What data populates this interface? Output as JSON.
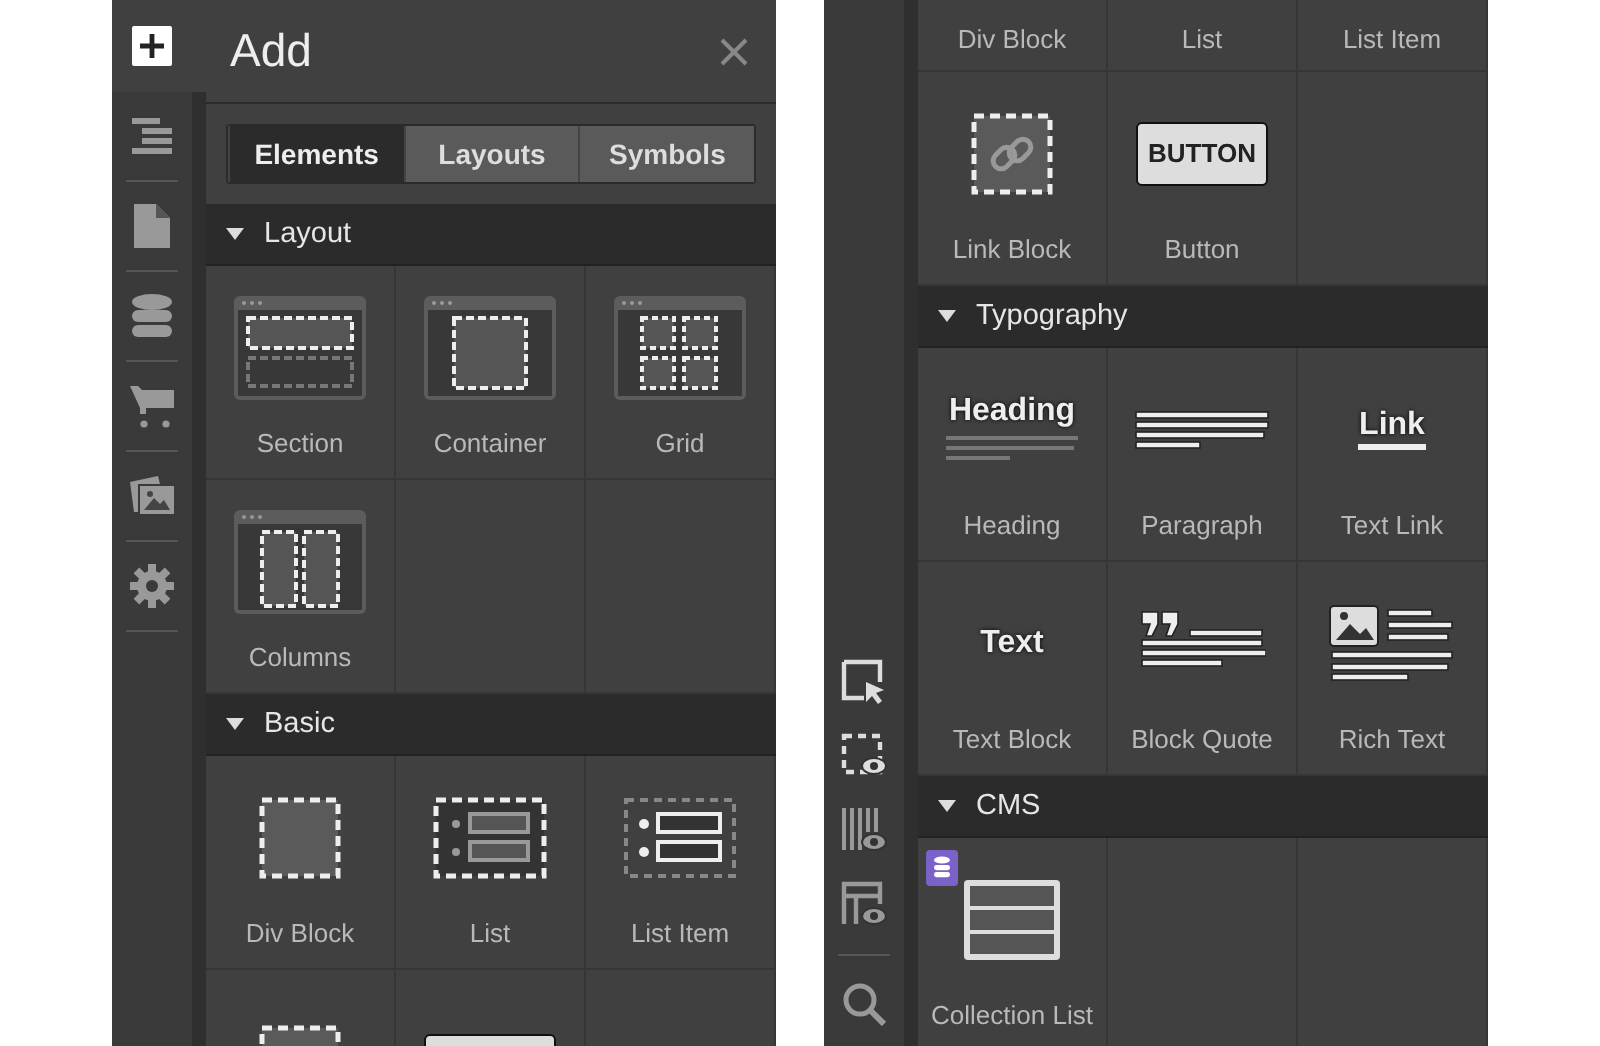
{
  "add_panel": {
    "rail": [
      {
        "kind": "add",
        "selected": true
      },
      {
        "kind": "navigator",
        "selected": false
      },
      {
        "kind": "pages",
        "selected": false
      },
      {
        "kind": "cms",
        "selected": false
      },
      {
        "kind": "ecommerce",
        "selected": false
      },
      {
        "kind": "assets",
        "selected": false
      },
      {
        "kind": "settings",
        "selected": false
      }
    ],
    "title": "Add",
    "tabs": [
      {
        "label": "Elements",
        "selected": true
      },
      {
        "label": "Layouts",
        "selected": false
      },
      {
        "label": "Symbols",
        "selected": false
      }
    ],
    "sections": [
      {
        "title": "Layout",
        "expanded": true,
        "items": [
          {
            "kind": "section",
            "label": "Section"
          },
          {
            "kind": "container",
            "label": "Container"
          },
          {
            "kind": "grid",
            "label": "Grid"
          },
          {
            "kind": "columns",
            "label": "Columns"
          }
        ]
      },
      {
        "title": "Basic",
        "expanded": true,
        "items": [
          {
            "kind": "div-block",
            "label": "Div Block"
          },
          {
            "kind": "list",
            "label": "List"
          },
          {
            "kind": "list-item",
            "label": "List Item"
          },
          {
            "kind": "link-block"
          },
          {
            "kind": "button"
          }
        ]
      }
    ]
  },
  "scrolled_panel": {
    "partial_row": [
      "Div Block",
      "List",
      "List Item"
    ],
    "items": [
      {
        "kind": "link-block",
        "label": "Link Block"
      },
      {
        "kind": "button",
        "label": "Button",
        "icon_text": "BUTTON"
      }
    ],
    "sections": [
      {
        "title": "Typography",
        "expanded": true,
        "items": [
          {
            "kind": "heading",
            "label": "Heading",
            "icon_text": "Heading"
          },
          {
            "kind": "paragraph",
            "label": "Paragraph"
          },
          {
            "kind": "text-link",
            "label": "Text Link",
            "icon_text": "Link"
          },
          {
            "kind": "text-block",
            "label": "Text Block",
            "icon_text": "Text"
          },
          {
            "kind": "block-quote",
            "label": "Block Quote"
          },
          {
            "kind": "rich-text",
            "label": "Rich Text"
          }
        ]
      },
      {
        "title": "CMS",
        "expanded": true,
        "items": [
          {
            "kind": "collection-list",
            "label": "Collection List"
          }
        ]
      }
    ]
  }
}
